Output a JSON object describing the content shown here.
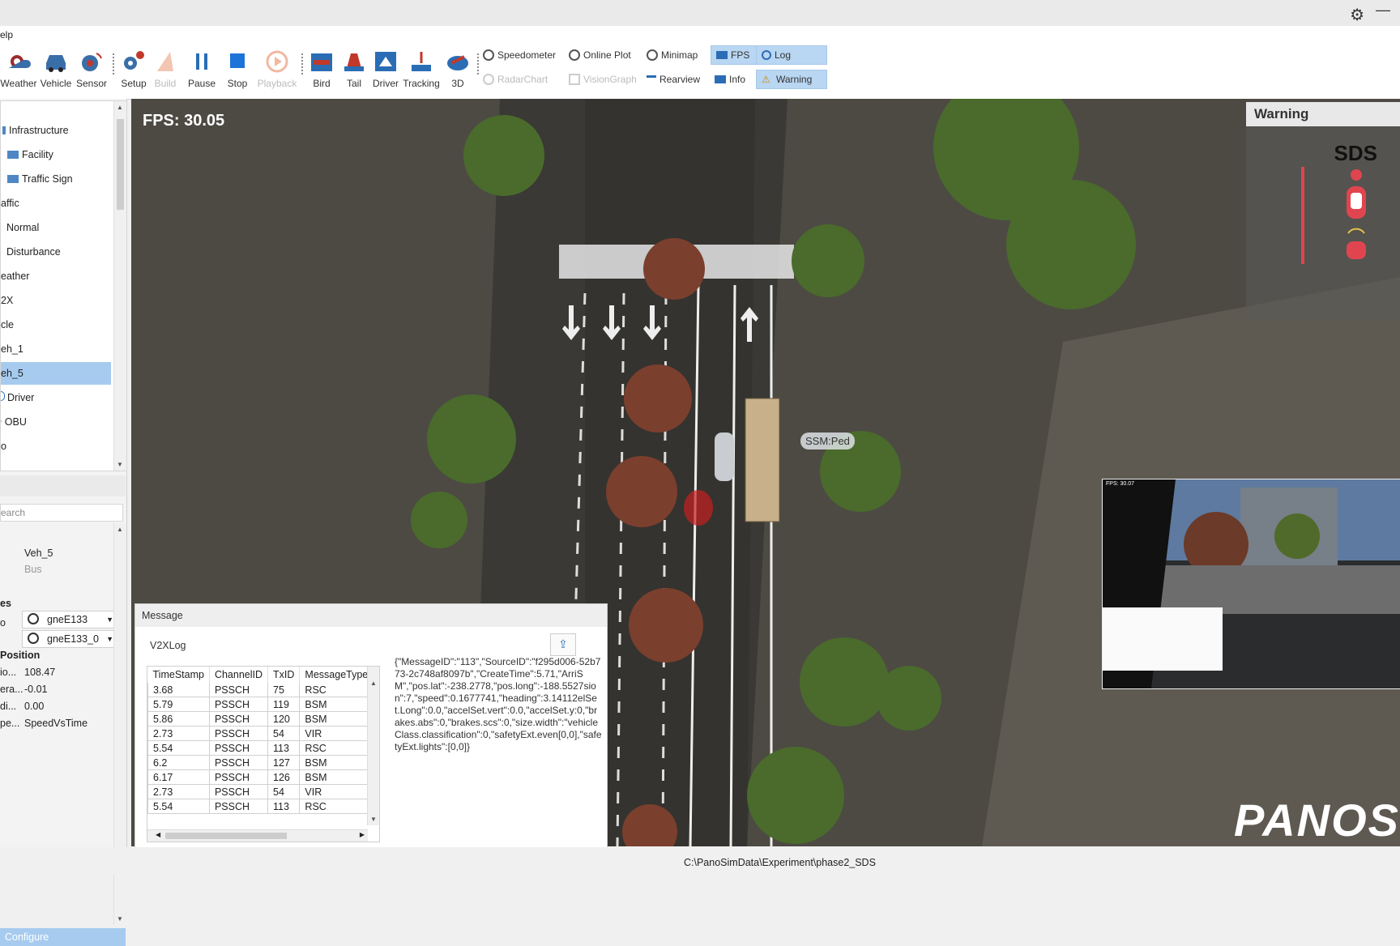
{
  "menu": {
    "help": "elp"
  },
  "ribbon": {
    "large": [
      {
        "label": "Weather"
      },
      {
        "label": "Vehicle"
      },
      {
        "label": "Sensor"
      },
      {
        "label": "Setup"
      },
      {
        "label": "Build"
      },
      {
        "label": "Pause"
      },
      {
        "label": "Stop"
      },
      {
        "label": "Playback"
      },
      {
        "label": "Bird"
      },
      {
        "label": "Tail"
      },
      {
        "label": "Driver"
      },
      {
        "label": "Tracking"
      },
      {
        "label": "3D"
      }
    ],
    "small": [
      {
        "label": "Speedometer"
      },
      {
        "label": "RadarChart"
      },
      {
        "label": "Online Plot"
      },
      {
        "label": "VisionGraph"
      },
      {
        "label": "Minimap"
      },
      {
        "label": "Rearview"
      },
      {
        "label": "FPS"
      },
      {
        "label": "Info"
      },
      {
        "label": "Log"
      },
      {
        "label": "Warning"
      }
    ]
  },
  "tree": {
    "items": [
      "Infrastructure",
      "Facility",
      "Traffic Sign",
      "affic",
      "Normal",
      "Disturbance",
      "eather",
      "2X",
      "cle",
      "eh_1",
      "eh_5",
      "Driver",
      "OBU",
      "o"
    ]
  },
  "props": {
    "search_placeholder": "earch",
    "name": "Veh_5",
    "type": "Bus",
    "section_routes": "es",
    "route_prefix": "o",
    "road": "gneE133",
    "lane": "gneE133_0",
    "section_position": "Position",
    "rows": [
      {
        "k": "io...",
        "v": "108.47"
      },
      {
        "k": "era...",
        "v": "-0.01"
      },
      {
        "k": "di...",
        "v": "0.00"
      },
      {
        "k": "pe...",
        "v": "SpeedVsTime"
      }
    ],
    "configure": "Configure"
  },
  "view": {
    "fps": "FPS: 30.05",
    "warning_title": "Warning",
    "sds": "SDS",
    "ssm_label": "SSM:Ped",
    "cam_fps": "FPS: 30.07",
    "logo": "PANOS"
  },
  "message": {
    "title": "Message",
    "log_title": "V2XLog",
    "columns": [
      "TimeStamp",
      "ChannelID",
      "TxID",
      "MessageType"
    ],
    "rows": [
      [
        "3.68",
        "PSSCH",
        "75",
        "RSC"
      ],
      [
        "5.79",
        "PSSCH",
        "119",
        "BSM"
      ],
      [
        "5.86",
        "PSSCH",
        "120",
        "BSM"
      ],
      [
        "2.73",
        "PSSCH",
        "54",
        "VIR"
      ],
      [
        "5.54",
        "PSSCH",
        "113",
        "RSC"
      ],
      [
        "6.2",
        "PSSCH",
        "127",
        "BSM"
      ],
      [
        "6.17",
        "PSSCH",
        "126",
        "BSM"
      ],
      [
        "2.73",
        "PSSCH",
        "54",
        "VIR"
      ],
      [
        "5.54",
        "PSSCH",
        "113",
        "RSC"
      ]
    ],
    "json_text": "{\"MessageID\":\"113\",\"SourceID\":\"f295d006-52b773-2c748af8097b\",\"CreateTime\":5.71,\"ArriSM\",\"pos.lat\":-238.2778,\"pos.long\":-188.5527sion\":7,\"speed\":0.1677741,\"heading\":3.14112elSet.Long\":0.0,\"accelSet.vert\":0.0,\"accelSet.y:0,\"brakes.abs\":0,\"brakes.scs\":0,\"size.width\":\"vehicleClass.classification\":0,\"safetyExt.even[0,0],\"safetyExt.lights\":[0,0]}"
  },
  "status": {
    "path": "C:\\PanoSimData\\Experiment\\phase2_SDS"
  },
  "colors": {
    "accent": "#a6cbef",
    "warning_red": "#e0454f"
  }
}
